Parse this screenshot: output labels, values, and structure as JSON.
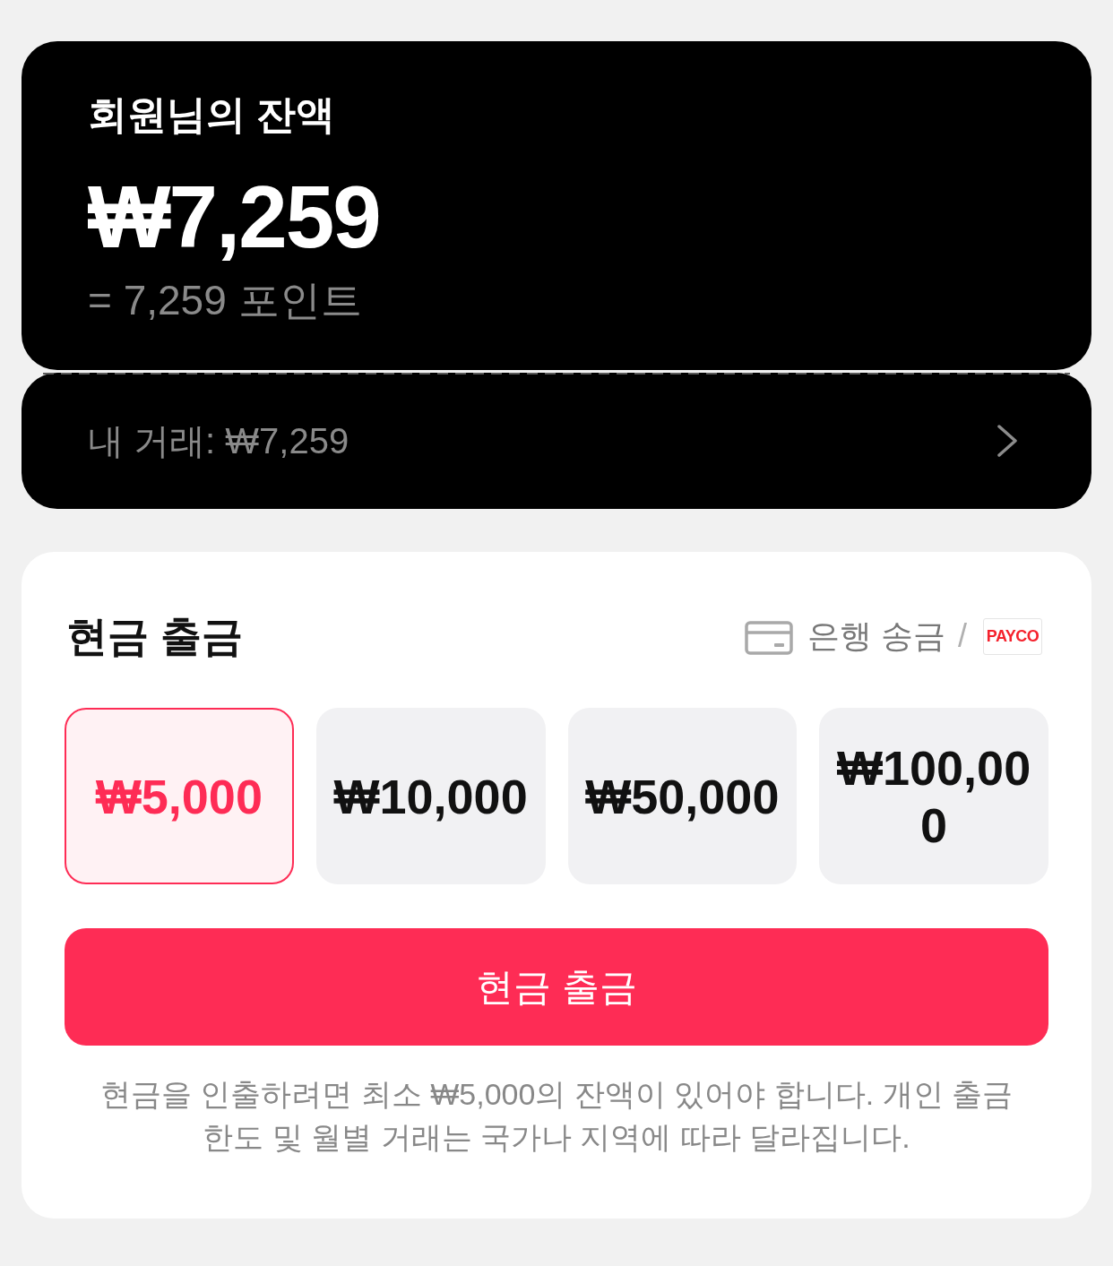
{
  "balance_card": {
    "title": "회원님의 잔액",
    "amount": "₩7,259",
    "points": "= 7,259 포인트"
  },
  "transactions_link": {
    "label": "내 거래: ₩7,259"
  },
  "withdraw": {
    "title": "현금 출금",
    "method": {
      "label": "은행 송금",
      "separator": "/",
      "logo": "PAYCO"
    },
    "amounts": [
      {
        "label": "₩5,000",
        "selected": true
      },
      {
        "label": "₩10,000",
        "selected": false
      },
      {
        "label": "₩50,000",
        "selected": false
      },
      {
        "label": "₩100,000",
        "selected": false
      }
    ],
    "button": "현금 출금",
    "note": "현금을 인출하려면 최소 ₩5,000의 잔액이 있어야 합니다. 개인 출금 한도 및 월별 거래는 국가나 지역에 따라 달라집니다."
  }
}
